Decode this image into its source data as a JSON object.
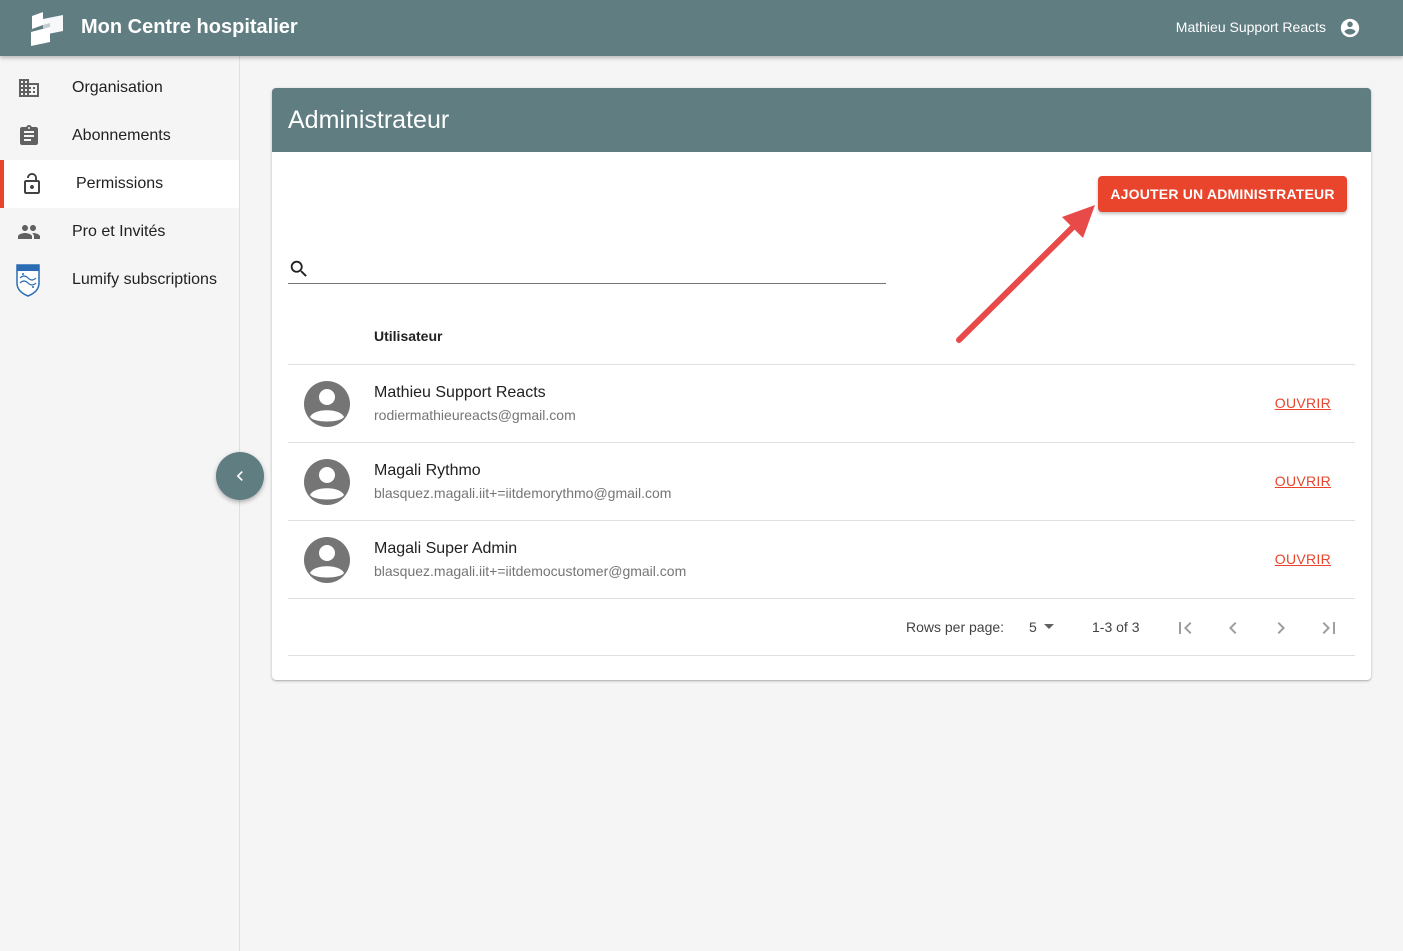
{
  "appbar": {
    "title": "Mon Centre hospitalier",
    "user_name": "Mathieu Support Reacts"
  },
  "sidebar": {
    "items": [
      {
        "label": "Organisation",
        "icon": "building-icon"
      },
      {
        "label": "Abonnements",
        "icon": "clipboard-icon"
      },
      {
        "label": "Permissions",
        "icon": "lock-open-icon",
        "active": true
      },
      {
        "label": "Pro et Invités",
        "icon": "people-icon"
      },
      {
        "label": "Lumify subscriptions",
        "icon": "philips-shield-icon"
      }
    ]
  },
  "main": {
    "title": "Administrateur",
    "add_button_label": "AJOUTER UN ADMINISTRATEUR",
    "search_placeholder": "",
    "column_header": "Utilisateur",
    "rows": [
      {
        "name": "Mathieu Support Reacts",
        "email": "rodiermathieureacts@gmail.com",
        "action": "OUVRIR"
      },
      {
        "name": "Magali Rythmo",
        "email": "blasquez.magali.iit+=iitdemorythmo@gmail.com",
        "action": "OUVRIR"
      },
      {
        "name": "Magali Super Admin",
        "email": "blasquez.magali.iit+=iitdemocustomer@gmail.com",
        "action": "OUVRIR"
      }
    ],
    "pagination": {
      "rows_per_page_label": "Rows per page:",
      "rows_per_page": "5",
      "range": "1-3 of 3"
    }
  },
  "colors": {
    "primary": "#607d82",
    "accent": "#e8452c",
    "annotation_arrow": "#e84a4a"
  }
}
